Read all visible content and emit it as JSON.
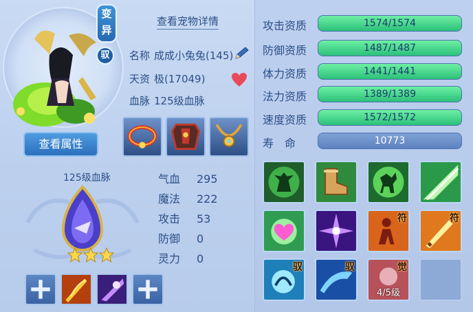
{
  "header": {
    "detail_link": "查看宠物详情",
    "variant_badge": [
      "变",
      "异"
    ],
    "ride_badge": "驭",
    "view_attr_button": "查看属性"
  },
  "info": {
    "name_label": "名称",
    "name_value": "成成小兔兔(145)",
    "aptitude_label": "天资",
    "aptitude_value": "极(17049)",
    "bloodline_label": "血脉",
    "bloodline_value": "125级血脉"
  },
  "equipment": [
    {
      "name": "red-collar",
      "icon": "collar-icon",
      "color": "#d23a2c"
    },
    {
      "name": "armor",
      "icon": "armor-icon",
      "color": "#c0392b"
    },
    {
      "name": "necklace",
      "icon": "necklace-icon",
      "color": "#e2a53a"
    }
  ],
  "bloodline": {
    "title": "125级血脉",
    "stars": 3
  },
  "stats": [
    {
      "label": "气血",
      "value": "295"
    },
    {
      "label": "魔法",
      "value": "222"
    },
    {
      "label": "攻击",
      "value": "53"
    },
    {
      "label": "防御",
      "value": "0"
    },
    {
      "label": "灵力",
      "value": "0"
    }
  ],
  "aptitudes": [
    {
      "label": "攻击资质",
      "text": "1574/1574",
      "fraction": 1.0
    },
    {
      "label": "防御资质",
      "text": "1487/1487",
      "fraction": 1.0
    },
    {
      "label": "体力资质",
      "text": "1441/1441",
      "fraction": 1.0
    },
    {
      "label": "法力资质",
      "text": "1389/1389",
      "fraction": 1.0
    },
    {
      "label": "速度资质",
      "text": "1572/1572",
      "fraction": 1.0
    }
  ],
  "life": {
    "label": "寿　命",
    "value": "10773"
  },
  "skills": [
    {
      "name": "skill-green-monster",
      "tag": "",
      "level": ""
    },
    {
      "name": "skill-boot",
      "tag": "",
      "level": ""
    },
    {
      "name": "skill-green-horse",
      "tag": "",
      "level": ""
    },
    {
      "name": "skill-green-slash",
      "tag": "",
      "level": ""
    },
    {
      "name": "skill-heart",
      "tag": "",
      "level": ""
    },
    {
      "name": "skill-purple-burst",
      "tag": "",
      "level": ""
    },
    {
      "name": "skill-rune-figure",
      "tag": "符",
      "level": ""
    },
    {
      "name": "skill-rune-sword",
      "tag": "符",
      "level": ""
    },
    {
      "name": "skill-ride-beast",
      "tag": "驭",
      "level": ""
    },
    {
      "name": "skill-ride-wave",
      "tag": "驭",
      "level": ""
    },
    {
      "name": "skill-awaken",
      "tag": "觉",
      "level": "4/5级"
    },
    {
      "name": "skill-empty",
      "tag": "",
      "level": ""
    }
  ],
  "colors": {
    "bar_fill": "#2bc07a",
    "accent_blue": "#2c70bd"
  }
}
